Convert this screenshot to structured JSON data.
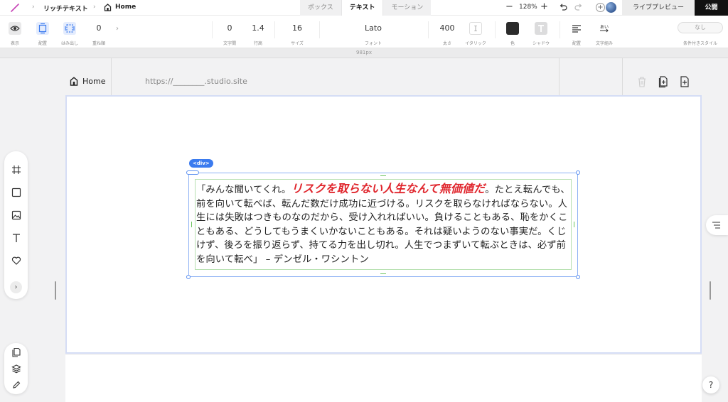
{
  "breadcrumb": {
    "item1": "リッチテキスト",
    "item2": "Home"
  },
  "mode_tabs": [
    "ボックス",
    "テキスト",
    "モーション"
  ],
  "zoom": {
    "minus": "−",
    "level": "128%",
    "plus": "+"
  },
  "header_buttons": {
    "add_member": "+",
    "live_preview": "ライブプレビュー",
    "publish": "公開"
  },
  "toolbar": {
    "display": {
      "label": "表示"
    },
    "placement": {
      "label": "配置"
    },
    "overflow": {
      "label": "はみ出し"
    },
    "stack_order": {
      "value": "0",
      "label": "重ね順"
    },
    "letter_spacing": {
      "value": "0",
      "label": "文字間"
    },
    "line_height": {
      "value": "1.4",
      "label": "行高"
    },
    "size": {
      "value": "16",
      "label": "サイズ"
    },
    "font": {
      "value": "Lato",
      "label": "フォント"
    },
    "weight": {
      "value": "400",
      "label": "太さ"
    },
    "italic": {
      "label": "イタリック"
    },
    "color": {
      "label": "色",
      "value": "#2b2b2b"
    },
    "shadow": {
      "label": "シャドウ"
    },
    "align": {
      "label": "配置"
    },
    "wrap": {
      "label": "文字組み"
    },
    "conditional": {
      "value": "なし",
      "label": "条件付きスタイル"
    }
  },
  "ruler": {
    "width_label": "981px"
  },
  "page": {
    "home_label": "Home",
    "url": "https://________.studio.site"
  },
  "selection": {
    "tag": "<div>"
  },
  "quote": {
    "pre": "「みんな聞いてくれ。",
    "emph": "リスクを取らない人生なんて無価値だ",
    "post": "。たとえ転んでも、前を向いて転べば、転んだ数だけ成功に近づける。リスクを取らなければならない。人生には失敗はつきものなのだから、受け入れればいい。負けることもある、恥をかくこともある、どうしてもうまくいかないこともある。それは疑いようのない事実だ。くじけず、後ろを振り返らず、持てる力を出し切れ。人生でつまずいて転ぶときは、必ず前を向いて転べ」 – デンゼル・ワシントン"
  },
  "help": {
    "label": "?"
  },
  "colors": {
    "accent": "#3b7bef",
    "emphasis": "#e0262d",
    "publish_bg": "#111111"
  }
}
